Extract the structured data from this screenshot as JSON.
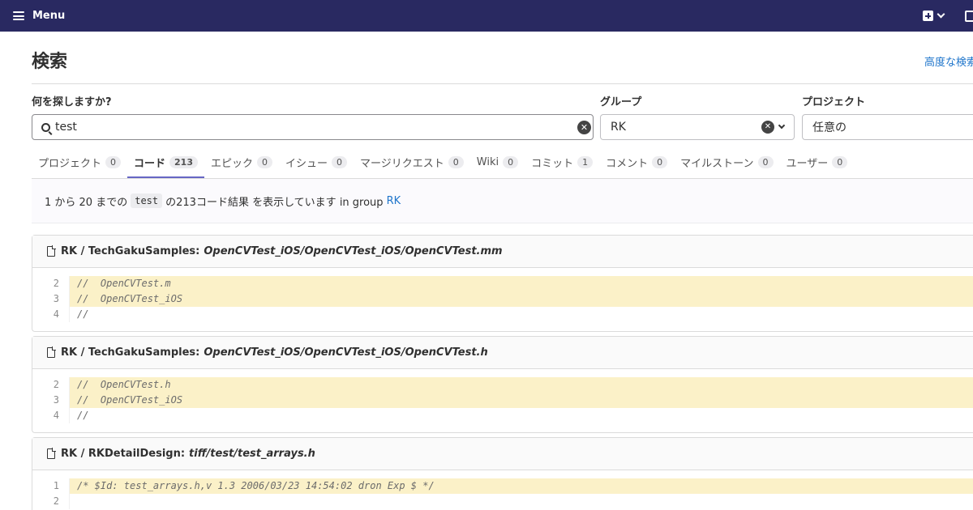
{
  "topbar": {
    "menu_label": "Menu"
  },
  "page": {
    "title": "検索",
    "advanced_search_link": "高度な検索"
  },
  "filters": {
    "query_label": "何を探しますか?",
    "query_value": "test",
    "group_label": "グループ",
    "group_value": "RK",
    "project_label": "プロジェクト",
    "project_value": "任意の"
  },
  "tabs": [
    {
      "label": "プロジェクト",
      "count": "0"
    },
    {
      "label": "コード",
      "count": "213",
      "active": true
    },
    {
      "label": "エピック",
      "count": "0"
    },
    {
      "label": "イシュー",
      "count": "0"
    },
    {
      "label": "マージリクエスト",
      "count": "0"
    },
    {
      "label": "Wiki",
      "count": "0"
    },
    {
      "label": "コミット",
      "count": "1"
    },
    {
      "label": "コメント",
      "count": "0"
    },
    {
      "label": "マイルストーン",
      "count": "0"
    },
    {
      "label": "ユーザー",
      "count": "0"
    }
  ],
  "summary": {
    "prefix": "1 から 20 までの",
    "term": "test",
    "middle": "の213コード結果 を表示しています in group",
    "group": "RK"
  },
  "results": [
    {
      "project": "RK / TechGakuSamples:",
      "path": "OpenCVTest_iOS/OpenCVTest_iOS/OpenCVTest.mm",
      "lines": [
        {
          "num": "2",
          "text": "//  OpenCVTest.m"
        },
        {
          "num": "3",
          "text": "//  OpenCVTest_iOS"
        },
        {
          "num": "4",
          "text": "//"
        }
      ]
    },
    {
      "project": "RK / TechGakuSamples:",
      "path": "OpenCVTest_iOS/OpenCVTest_iOS/OpenCVTest.h",
      "lines": [
        {
          "num": "2",
          "text": "//  OpenCVTest.h"
        },
        {
          "num": "3",
          "text": "//  OpenCVTest_iOS"
        },
        {
          "num": "4",
          "text": "//"
        }
      ]
    },
    {
      "project": "RK / RKDetailDesign:",
      "path": "tiff/test/test_arrays.h",
      "lines": [
        {
          "num": "1",
          "text": "/* $Id: test_arrays.h,v 1.3 2006/03/23 14:54:02 dron Exp $ */"
        },
        {
          "num": "2",
          "text": ""
        }
      ]
    }
  ]
}
